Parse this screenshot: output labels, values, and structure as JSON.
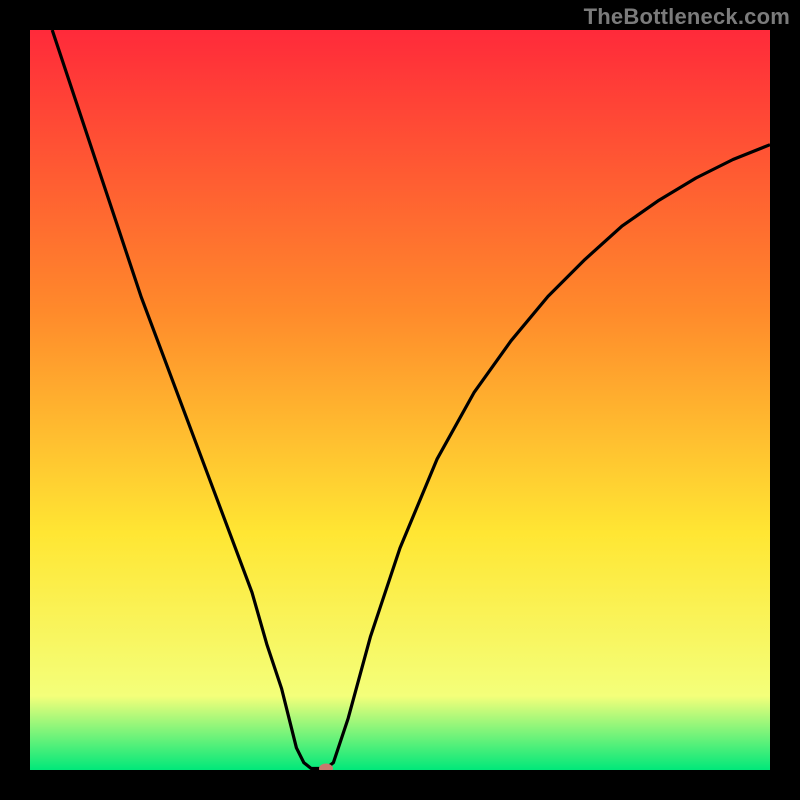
{
  "watermark": "TheBottleneck.com",
  "chart_data": {
    "type": "line",
    "title": "",
    "xlabel": "",
    "ylabel": "",
    "xlim": [
      0,
      100
    ],
    "ylim": [
      0,
      100
    ],
    "background_gradient": {
      "top": "#ff2a3a",
      "mid_upper": "#ff8a2b",
      "mid": "#ffe633",
      "mid_lower": "#f4ff7a",
      "base": "#00e87a"
    },
    "series": [
      {
        "name": "bottleneck-curve",
        "color": "#000000",
        "points": [
          {
            "x": 3,
            "y": 100
          },
          {
            "x": 6,
            "y": 91
          },
          {
            "x": 9,
            "y": 82
          },
          {
            "x": 12,
            "y": 73
          },
          {
            "x": 15,
            "y": 64
          },
          {
            "x": 18,
            "y": 56
          },
          {
            "x": 21,
            "y": 48
          },
          {
            "x": 24,
            "y": 40
          },
          {
            "x": 27,
            "y": 32
          },
          {
            "x": 30,
            "y": 24
          },
          {
            "x": 32,
            "y": 17
          },
          {
            "x": 34,
            "y": 11
          },
          {
            "x": 35,
            "y": 7
          },
          {
            "x": 36,
            "y": 3
          },
          {
            "x": 37,
            "y": 1
          },
          {
            "x": 38,
            "y": 0.2
          },
          {
            "x": 39,
            "y": 0.2
          },
          {
            "x": 40,
            "y": 0.2
          },
          {
            "x": 41,
            "y": 1
          },
          {
            "x": 43,
            "y": 7
          },
          {
            "x": 46,
            "y": 18
          },
          {
            "x": 50,
            "y": 30
          },
          {
            "x": 55,
            "y": 42
          },
          {
            "x": 60,
            "y": 51
          },
          {
            "x": 65,
            "y": 58
          },
          {
            "x": 70,
            "y": 64
          },
          {
            "x": 75,
            "y": 69
          },
          {
            "x": 80,
            "y": 73.5
          },
          {
            "x": 85,
            "y": 77
          },
          {
            "x": 90,
            "y": 80
          },
          {
            "x": 95,
            "y": 82.5
          },
          {
            "x": 100,
            "y": 84.5
          }
        ]
      }
    ],
    "marker": {
      "x": 40,
      "y": 0.2,
      "color": "#c77a6e"
    }
  }
}
